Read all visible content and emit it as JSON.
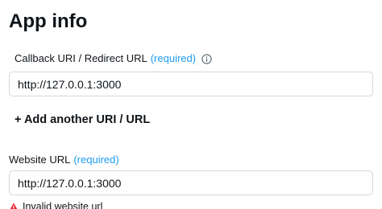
{
  "section": {
    "title": "App info"
  },
  "callback_field": {
    "label": "Callback URI / Redirect URL",
    "required_text": "(required)",
    "info_icon": "info-icon",
    "value": "http://127.0.0.1:3000"
  },
  "add_uri": {
    "label": "+ Add another URI / URL"
  },
  "website_field": {
    "label": "Website URL",
    "required_text": "(required)",
    "value": "http://127.0.0.1:3000",
    "error": {
      "icon": "warning-icon",
      "text": "Invalid website url"
    }
  },
  "colors": {
    "required": "#1d9bf0",
    "error_icon": "#f4212e",
    "border": "#cfd9de",
    "text": "#0f1419"
  }
}
